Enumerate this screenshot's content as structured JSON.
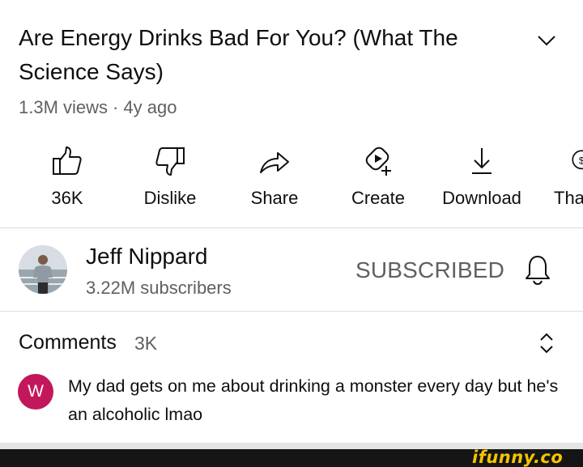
{
  "video": {
    "title": "Are Energy Drinks Bad For You? (What The Science Says)",
    "views": "1.3M views",
    "separator": "·",
    "age": "4y ago"
  },
  "actions": [
    {
      "icon": "thumbs-up-icon",
      "label": "36K"
    },
    {
      "icon": "thumbs-down-icon",
      "label": "Dislike"
    },
    {
      "icon": "share-icon",
      "label": "Share"
    },
    {
      "icon": "create-icon",
      "label": "Create"
    },
    {
      "icon": "download-icon",
      "label": "Download"
    },
    {
      "icon": "thanks-icon",
      "label": "Tha"
    }
  ],
  "channel": {
    "name": "Jeff Nippard",
    "subscribers": "3.22M subscribers",
    "subscribe_label": "SUBSCRIBED"
  },
  "comments": {
    "title": "Comments",
    "count": "3K",
    "first": {
      "avatar_letter": "W",
      "avatar_color": "#c2185b",
      "text": "My dad gets on me about drinking a monster every day but he's an alcoholic lmao"
    }
  },
  "watermark": "ifunny.co"
}
